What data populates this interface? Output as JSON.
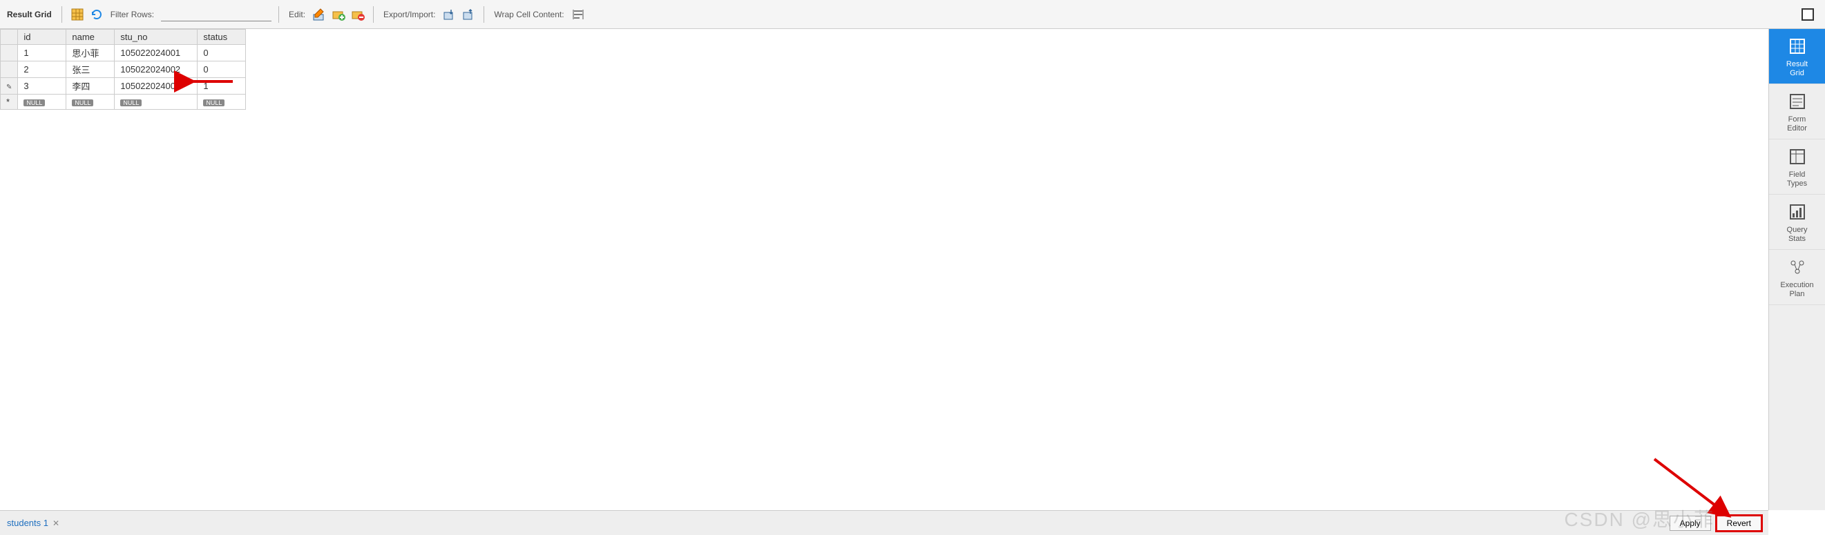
{
  "toolbar": {
    "result_grid_label": "Result Grid",
    "filter_rows_label": "Filter Rows:",
    "filter_value": "",
    "edit_label": "Edit:",
    "export_import_label": "Export/Import:",
    "wrap_label": "Wrap Cell Content:"
  },
  "table": {
    "columns": [
      "id",
      "name",
      "stu_no",
      "status"
    ],
    "rows": [
      {
        "gutter": "",
        "cells": [
          "1",
          "思小菲",
          "105022024001",
          "0"
        ]
      },
      {
        "gutter": "",
        "cells": [
          "2",
          "张三",
          "105022024002",
          "0"
        ]
      },
      {
        "gutter": "✎",
        "cells": [
          "3",
          "李四",
          "105022024003",
          "1"
        ]
      },
      {
        "gutter": "*",
        "cells": [
          "NULL",
          "NULL",
          "NULL",
          "NULL"
        ],
        "null_row": true
      }
    ]
  },
  "side": {
    "items": [
      {
        "label": "Result\nGrid",
        "active": true,
        "icon": "grid"
      },
      {
        "label": "Form\nEditor",
        "active": false,
        "icon": "form"
      },
      {
        "label": "Field\nTypes",
        "active": false,
        "icon": "fields"
      },
      {
        "label": "Query\nStats",
        "active": false,
        "icon": "stats"
      },
      {
        "label": "Execution\nPlan",
        "active": false,
        "icon": "plan"
      }
    ]
  },
  "bottom": {
    "tab_label": "students 1",
    "apply_label": "Apply",
    "revert_label": "Revert"
  },
  "watermark": "CSDN @思小菲"
}
